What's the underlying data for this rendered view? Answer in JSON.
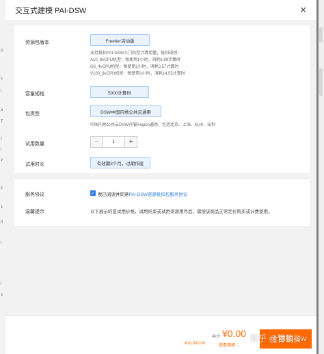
{
  "background": {
    "left_fragments": [
      "P",
      "s",
      "i",
      "o",
      "T",
      "I",
      "l",
      "v",
      "ii",
      "1",
      "0",
      "l",
      "i",
      "s"
    ]
  },
  "drawer": {
    "title": "交互式建模 PAI-DSW",
    "close_icon": "close-icon"
  },
  "form": {
    "package_version": {
      "label": "资源包版本",
      "selected": "Freetier活动版",
      "notes": [
        "支持抵扣PAI-DSW入门机型计算用量，抵扣规则：",
        "A10_8vCPU机型：每使用1小时，消耗6.99计算时",
        "G6_4vCPU机型：每使用1小时，消耗0.57计算时",
        "V100_8vCPU机型：每使用1小时，消耗14.55计算时"
      ]
    },
    "capacity": {
      "label": "容量规格",
      "selected": "5000计算时"
    },
    "package_type": {
      "label": "包类型",
      "selected": "DSW中国内地公共云通用",
      "note": "中国内地公共云DSW开服Region通用，包括北京、上海、杭州、深圳"
    },
    "quantity": {
      "label": "试用数量",
      "value": "1",
      "minus": "−",
      "plus": "+"
    },
    "duration": {
      "label": "试用时长",
      "selected": "有效期3个月，过期作废"
    }
  },
  "agreement": {
    "label": "服务协议",
    "checked_mark": "✓",
    "prefix": "我已阅读并同意",
    "link": "PAI-DSW资源抵扣包服务协议"
  },
  "tips": {
    "label": "温馨提示",
    "text": "以下展示的是试用价格，试用结束或试用资源用尽后，需按该商品正常定价购买或计费使用。"
  },
  "footer": {
    "total_label": "共计",
    "price": "¥0.00",
    "original_price": "¥10,000.00",
    "discount_link": "查看明细 ⌄",
    "buy_label": "立即购买",
    "watermark": "知乎 @管狼-sw"
  },
  "colors": {
    "accent": "#ff6a00",
    "link": "#2f7fe0",
    "selected_bg": "#e9f2fd",
    "selected_border": "#a8c8ee"
  }
}
